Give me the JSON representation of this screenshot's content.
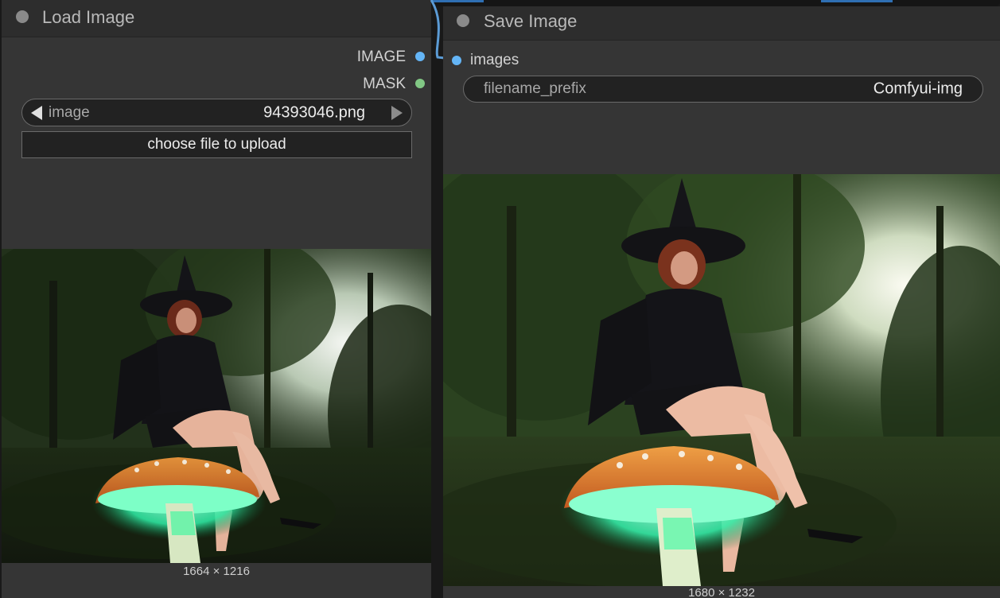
{
  "nodes": {
    "load_image": {
      "title": "Load Image",
      "outputs": [
        {
          "label": "IMAGE",
          "color": "#64b5f6"
        },
        {
          "label": "MASK",
          "color": "#81c784"
        }
      ],
      "image_widget": {
        "label": "image",
        "value": "94393046.png"
      },
      "upload_button": "choose file to upload",
      "preview_size": "1664 × 1216"
    },
    "save_image": {
      "title": "Save Image",
      "inputs": [
        {
          "label": "images",
          "color": "#64b5f6"
        }
      ],
      "prefix_widget": {
        "label": "filename_prefix",
        "value": "Comfyui-img"
      },
      "preview_size": "1680 × 1232"
    }
  },
  "colors": {
    "link": "#5b9bd5",
    "node_body": "#353535",
    "node_header": "#2d2d2d"
  }
}
